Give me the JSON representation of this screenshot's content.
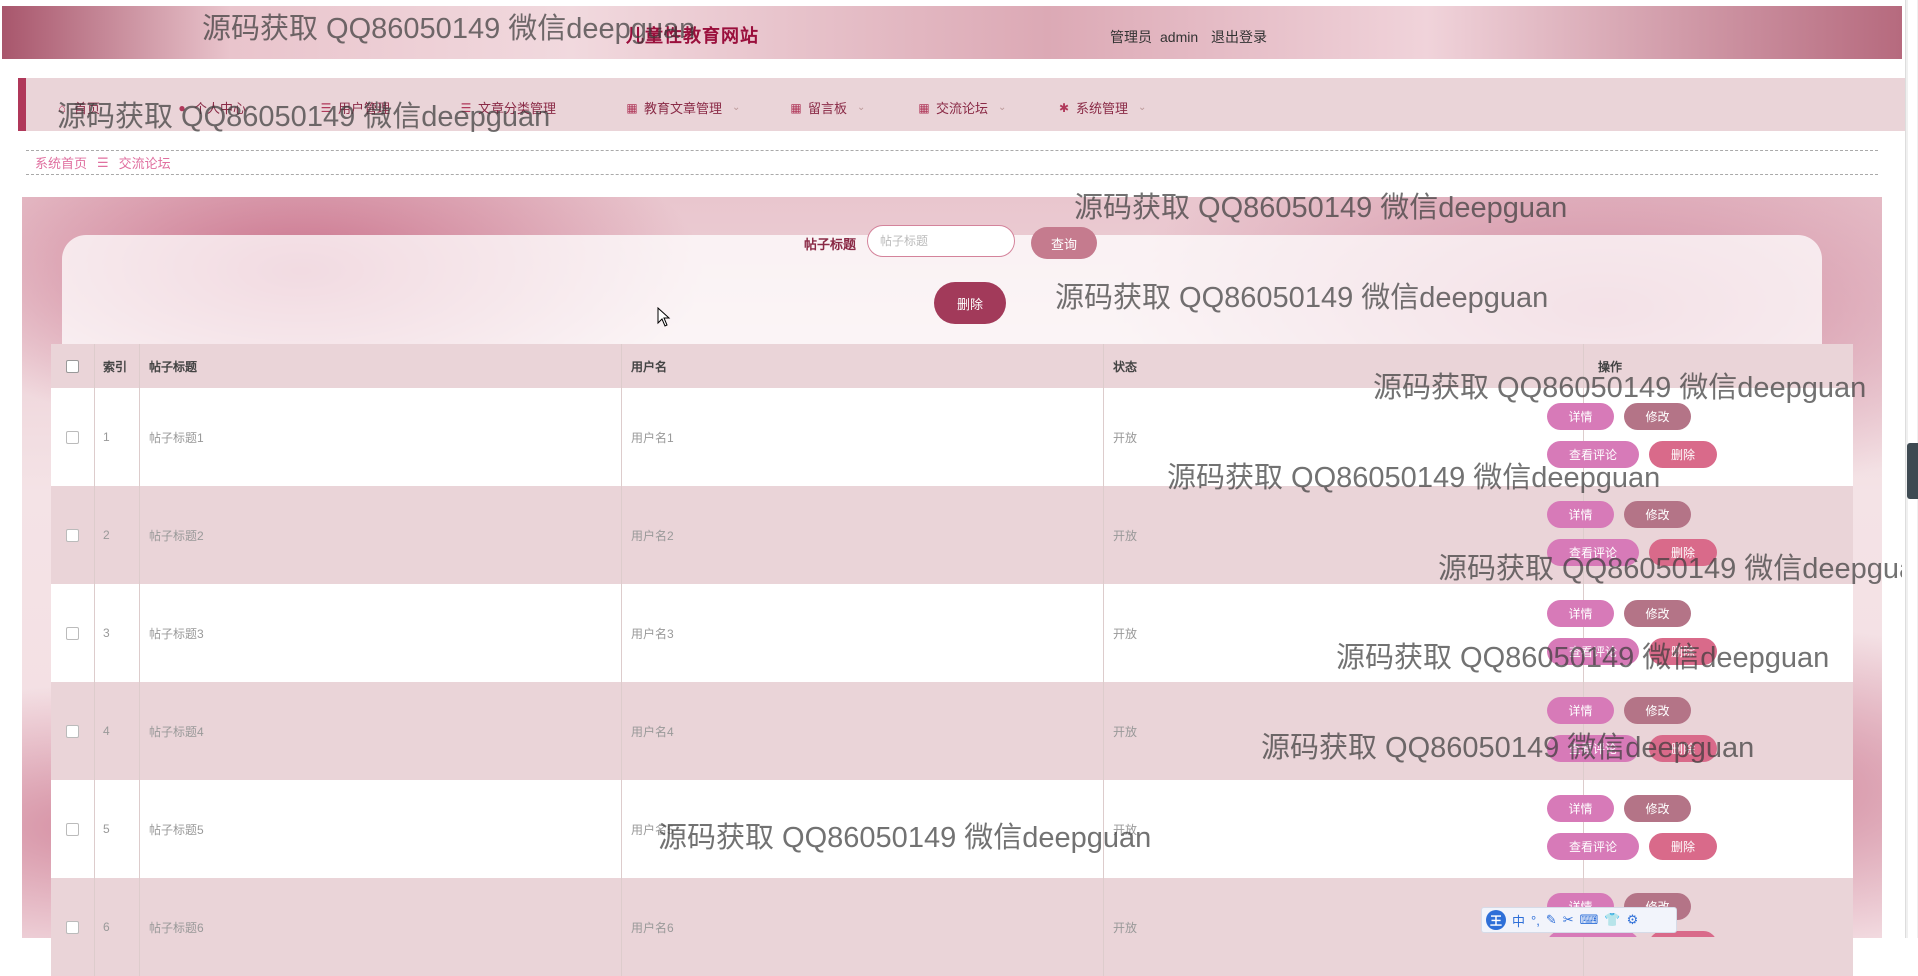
{
  "header": {
    "site_title": "儿童性教育网站",
    "role": "管理员",
    "username": "admin",
    "logout": "退出登录"
  },
  "nav": [
    {
      "label": "首页",
      "icon": "home-icon"
    },
    {
      "label": "个人中心",
      "icon": "user-icon"
    },
    {
      "label": "用户管理",
      "icon": "list-icon"
    },
    {
      "label": "文章分类管理",
      "icon": "list-icon"
    },
    {
      "label": "教育文章管理",
      "icon": "grid-icon"
    },
    {
      "label": "留言板",
      "icon": "grid-icon"
    },
    {
      "label": "交流论坛",
      "icon": "grid-icon"
    },
    {
      "label": "系统管理",
      "icon": "settings-icon"
    }
  ],
  "breadcrumb": {
    "home": "系统首页",
    "separator": "☰",
    "current": "交流论坛"
  },
  "search": {
    "label": "帖子标题",
    "placeholder": "帖子标题",
    "query_button": "查询",
    "delete_button": "删除"
  },
  "table": {
    "columns": [
      "索引",
      "帖子标题",
      "用户名",
      "状态",
      "操作"
    ],
    "rows": [
      {
        "index": "1",
        "title": "帖子标题1",
        "user": "用户名1",
        "status": "开放"
      },
      {
        "index": "2",
        "title": "帖子标题2",
        "user": "用户名2",
        "status": "开放"
      },
      {
        "index": "3",
        "title": "帖子标题3",
        "user": "用户名3",
        "status": "开放"
      },
      {
        "index": "4",
        "title": "帖子标题4",
        "user": "用户名4",
        "status": "开放"
      },
      {
        "index": "5",
        "title": "帖子标题5",
        "user": "用户名5",
        "status": "开放"
      },
      {
        "index": "6",
        "title": "帖子标题6",
        "user": "用户名6",
        "status": "开放"
      }
    ],
    "actions": {
      "detail": "详情",
      "edit": "修改",
      "comments": "查看评论",
      "delete": "删除"
    }
  },
  "watermark": "源码获取 QQ86050149 微信deepguan",
  "ime": {
    "logo": "王",
    "items": [
      "中",
      "°,",
      "✎",
      "✂",
      "⌨",
      "👕",
      "⚙"
    ]
  },
  "colors": {
    "accent": "#b0385a",
    "title": "#9a0f3c",
    "nav_bg": "#ead4d8",
    "detail_btn": "#d77ab8",
    "edit_btn": "#b47487",
    "delete_btn": "#d96a8a"
  }
}
